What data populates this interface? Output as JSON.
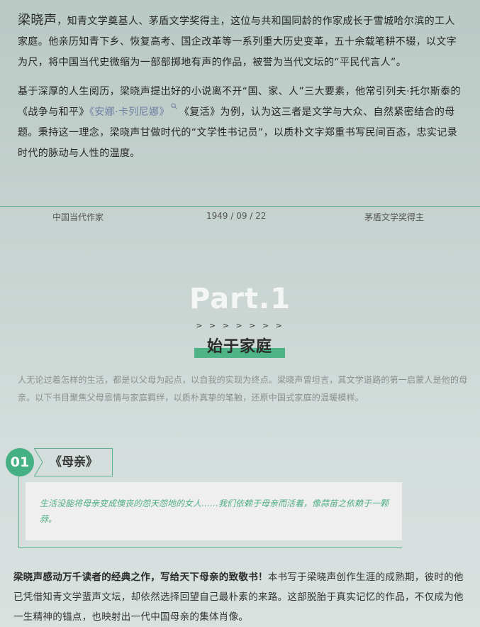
{
  "intro": {
    "name": "梁晓声",
    "p1_rest": "，知青文学奠基人、茅盾文学奖得主，这位与共和国同龄的作家成长于雪城哈尔滨的工人家庭。他亲历知青下乡、恢复高考、国企改革等一系列重大历史变革，五十余载笔耕不辍，以文字为尺，将中国当代史微缩为一部部掷地有声的作品，被誉为当代文坛的“平民代言人”。",
    "p2_a": "基于深厚的人生阅历，梁晓声提出好的小说离不开“国、家、人”三大要素，他常引列夫·托尔斯泰的《战争与和平》",
    "p2_link": "《安娜·卡列尼娜》",
    "p2_b": "《复活》为例，认为这三者是文学与大众、自然紧密结合的母题。秉持这一理念，梁晓声甘做时代的“文学性书记员”，以质朴文字郑重书写民间百态，忠实记录时代的脉动与人性的温度。"
  },
  "meta": {
    "category": "中国当代作家",
    "date": "1949 / 09 / 22",
    "award": "茅盾文学奖得主"
  },
  "section": {
    "part": "Part.1",
    "arrows": "> > > > > > >",
    "title": "始于家庭",
    "lead": "人无论过着怎样的生活，都是以父母为起点，以自我的实现为终点。梁晓声曾坦言，其文学道路的第一启蒙人是他的母亲。以下书目聚焦父母恩情与家庭羁绊，以质朴真挚的笔触，还原中国式家庭的温暖模样。"
  },
  "book": {
    "number": "01",
    "title": "《母亲》",
    "quote": "生活没能将母亲变成懊丧的怨天怨地的女人……我们依赖于母亲而活着，像蒜苗之依赖于一颗蒜。",
    "body_strong": "梁晓声感动万千读者的经典之作，写给天下母亲的致敬书！",
    "body_rest": "本书写于梁晓声创作生涯的成熟期，彼时的他已凭借知青文学蜚声文坛，却依然选择回望自己最朴素的来路。这部脱胎于真实记忆的作品，不仅成为他一生精神的锚点，也映射出一代中国母亲的集体肖像。"
  },
  "colors": {
    "accent": "#4fb388",
    "link": "#6d7fa3",
    "quote": "#4fae85"
  },
  "icons": {
    "search": "search-icon"
  }
}
